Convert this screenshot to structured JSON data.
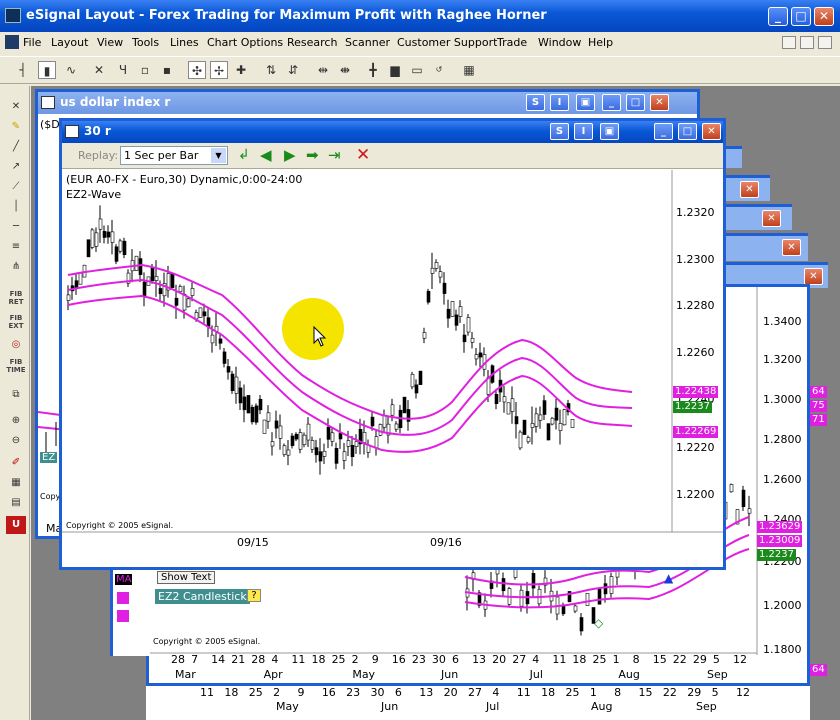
{
  "app": {
    "title": "eSignal Layout - Forex Trading for Maximum Profit with Raghee Horner",
    "minimize": "_",
    "maximize": "□",
    "close": "✕"
  },
  "menu": [
    "File",
    "Layout",
    "View",
    "Tools",
    "Lines",
    "Chart Options",
    "Research",
    "Scanner",
    "Customer Support",
    "Trade",
    "Window",
    "Help"
  ],
  "left_toolbar": {
    "fib_ret": "FIB RET",
    "fib_ext": "FIB EXT",
    "fib_time": "FIB TIME"
  },
  "windows": {
    "usdx": {
      "title": "us dollar index r",
      "header": "($DX"
    },
    "back": {
      "axis_right": [
        "1.3400",
        "1.3200",
        "1.3000",
        "1.2800",
        "1.2600",
        "1.2400",
        "1.2200",
        "1.2000",
        "1.1800"
      ],
      "months_top": [
        "28",
        "7",
        "14",
        "21",
        "28",
        "4",
        "11",
        "18",
        "25",
        "2",
        "9",
        "16",
        "23",
        "30",
        "6",
        "13",
        "20",
        "27",
        "4",
        "11",
        "18",
        "25",
        "1",
        "8",
        "15",
        "22",
        "29",
        "5",
        "12"
      ],
      "month_names": [
        "Mar",
        "Apr",
        "May",
        "Jun",
        "Jul",
        "Aug",
        "Sep"
      ],
      "tags": [
        "1.23629",
        "1.23009",
        "1.2237"
      ],
      "show_text": "Show Text",
      "study": "EZ2 Candlestick",
      "study_q": "?",
      "copyright": "Copyright © 2005 eSignal."
    },
    "bottom": {
      "days": [
        "11",
        "18",
        "25",
        "2",
        "9",
        "16",
        "23",
        "30",
        "6",
        "13",
        "20",
        "27",
        "4",
        "11",
        "18",
        "25",
        "1",
        "8",
        "15",
        "22",
        "29",
        "5",
        "12"
      ],
      "months": [
        "May",
        "Jun",
        "Jul",
        "Aug",
        "Sep"
      ]
    },
    "main": {
      "title": "30 r",
      "replay_label": "Replay:",
      "replay_value": "1 Sec per Bar",
      "symbol_line": "(EUR A0-FX - Euro,30) Dynamic,0:00-24:00",
      "study": "EZ2-Wave",
      "y_ticks": [
        "1.2320",
        "1.2300",
        "1.2280",
        "1.2260",
        "1.2240",
        "1.2220",
        "1.2200"
      ],
      "x_labels": [
        "09/15",
        "09/16"
      ],
      "tags": [
        {
          "text": "1.22438",
          "color": "#e020e0"
        },
        {
          "text": "1.2237",
          "color": "#1a8a1a"
        },
        {
          "text": "1.22269",
          "color": "#e020e0"
        }
      ],
      "copyright": "Copyright © 2005 eSignal."
    },
    "side_titles": [
      "",
      "",
      ""
    ],
    "side_tags": [
      "64",
      "75",
      "71",
      "64"
    ]
  },
  "colors": {
    "accent": "#0a58d6",
    "wave": "#e020e0",
    "candle": "#000000",
    "highlight": "#f5e400"
  }
}
